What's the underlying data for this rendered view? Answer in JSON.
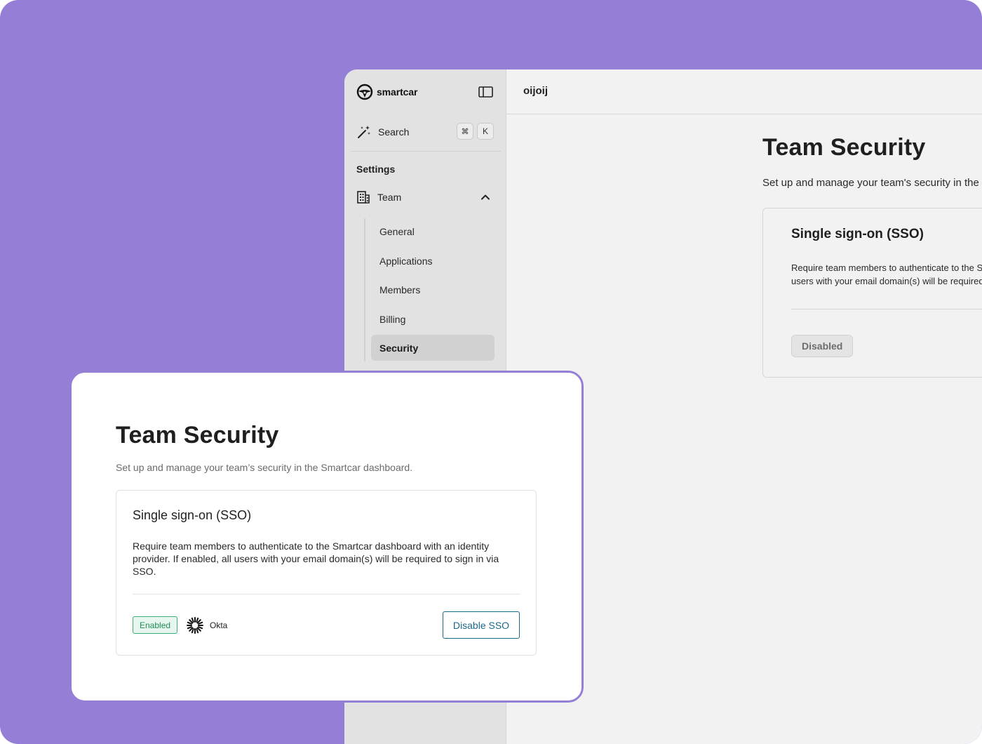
{
  "brand": {
    "name": "smartcar"
  },
  "sidebar": {
    "search_label": "Search",
    "shortcut_modifier": "⌘",
    "shortcut_key": "K",
    "section_label": "Settings",
    "team_label": "Team",
    "sub_items": [
      {
        "label": "General",
        "active": false
      },
      {
        "label": "Applications",
        "active": false
      },
      {
        "label": "Members",
        "active": false
      },
      {
        "label": "Billing",
        "active": false
      },
      {
        "label": "Security",
        "active": true
      }
    ]
  },
  "header": {
    "workspace": "oijoij"
  },
  "background_page": {
    "title": "Team Security",
    "subtitle": "Set up and manage your team's security in the Smartcar dashboard.",
    "sso_card": {
      "title": "Single sign-on (SSO)",
      "description": "Require team members to authenticate to the Smartcar dashboard with an identity provider. If enabled, all users with your email domain(s) will be required to sign in via SSO.",
      "status": "Disabled"
    }
  },
  "front_card": {
    "title": "Team Security",
    "subtitle": "Set up and manage your team’s security in the Smartcar dashboard.",
    "sso_card": {
      "title": "Single sign-on (SSO)",
      "description": "Require team members to authenticate to the Smartcar dashboard with an identity provider. If enabled, all users with your email domain(s) will be required to sign in via SSO.",
      "status": "Enabled",
      "provider": "Okta",
      "action_label": "Disable SSO"
    }
  },
  "colors": {
    "background": "#957fd6",
    "sidebar": "#e2e2e2",
    "enabled_green": "#1f8f57",
    "action_blue": "#1a6a8a"
  }
}
